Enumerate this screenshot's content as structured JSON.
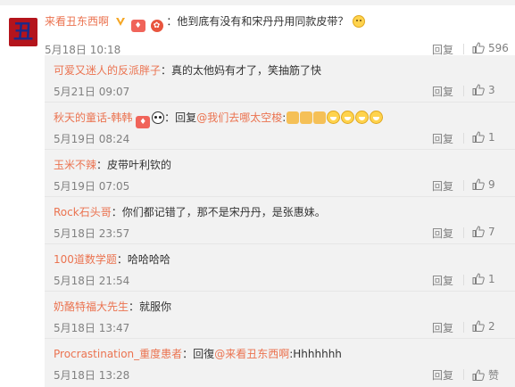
{
  "main_comment": {
    "username": "来看丑东西啊",
    "avatar_text": "丑",
    "text": "：他到底有没有和宋丹丹用同款皮带？",
    "time": "5月18日 10:18",
    "reply_label": "回复",
    "like_count": "596"
  },
  "replies": [
    {
      "name": "可爱又迷人的反派胖子",
      "text": "：真的太他妈有才了，笑抽筋了快",
      "time": "5月21日 09:07",
      "reply_label": "回复",
      "likes": "3"
    },
    {
      "name": "秋天的童话-韩韩",
      "prefix": "：回复",
      "mention": "@我们去哪太空梭",
      "text": ":",
      "time": "5月19日 08:24",
      "reply_label": "回复",
      "likes": "1"
    },
    {
      "name": "玉米不辣",
      "text": "：皮带叶利钦的",
      "time": "5月19日 07:05",
      "reply_label": "回复",
      "likes": "9"
    },
    {
      "name": "Rock石头哥",
      "text": "：你们都记错了，那不是宋丹丹，是张惠妹。",
      "time": "5月18日 23:57",
      "reply_label": "回复",
      "likes": "7"
    },
    {
      "name": "100道数学题",
      "text": "：哈哈哈哈",
      "time": "5月18日 21:54",
      "reply_label": "回复",
      "likes": "1"
    },
    {
      "name": "奶酪特福大先生",
      "text": "：就服你",
      "time": "5月18日 13:47",
      "reply_label": "回复",
      "likes": "2"
    },
    {
      "name": "Procrastination_重度患者",
      "prefix": "：回復",
      "mention": "@来看丑东西啊",
      "text": ":Hhhhhhh",
      "time": "5月18日 13:28",
      "reply_label": "回复",
      "likes": "赞"
    }
  ],
  "colors": {
    "accent": "#eb7350",
    "muted": "#808080",
    "reply_bg": "#f2f2f2"
  }
}
